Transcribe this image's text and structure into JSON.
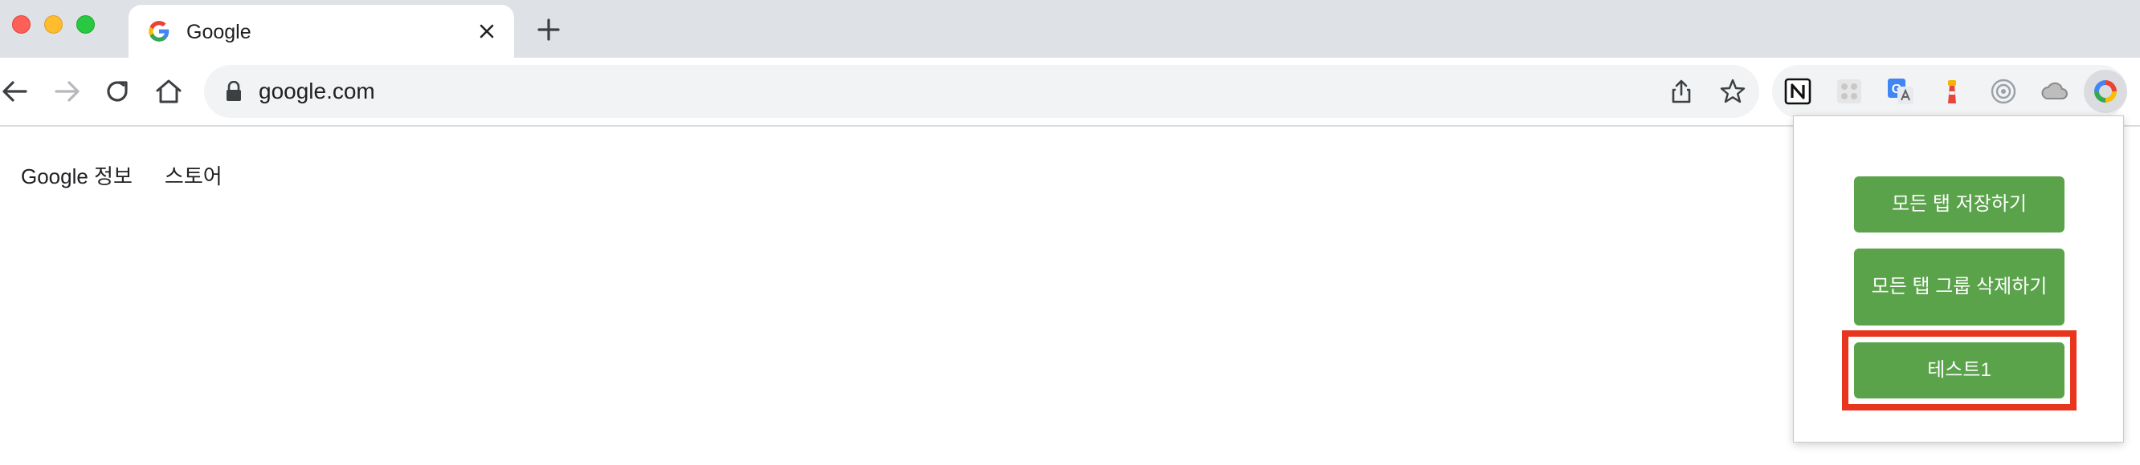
{
  "tab": {
    "title": "Google"
  },
  "address_bar": {
    "url": "google.com"
  },
  "page": {
    "links": [
      "Google 정보",
      "스토어"
    ]
  },
  "extension_popup": {
    "buttons": [
      "모든 탭 저장하기",
      "모든 탭 그룹 삭제하기",
      "테스트1"
    ],
    "button_color": "#5aa34b",
    "highlight_color": "#e8351e"
  },
  "extensions": [
    "notion-icon",
    "puzzle-grid-icon",
    "google-translate-icon",
    "lighthouse-icon",
    "target-icon",
    "cloud-icon",
    "tab-saver-icon"
  ],
  "colors": {
    "tabstrip": "#dee1e6",
    "omnibox": "#f1f3f4"
  }
}
